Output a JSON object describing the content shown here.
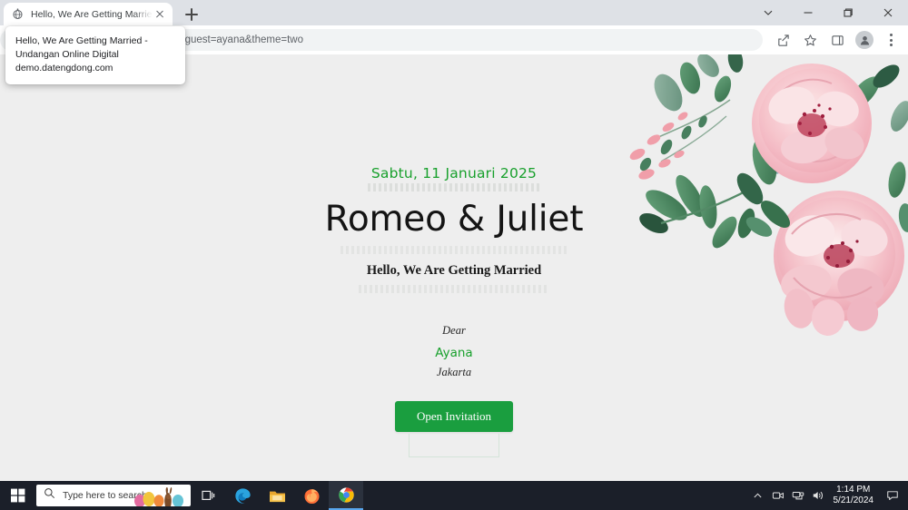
{
  "browser": {
    "tab": {
      "title": "Hello, We Are Getting Married - ",
      "favicon": "globe-icon",
      "close": "close-icon"
    },
    "new_tab_label": "+",
    "window_controls": {
      "chevron": "chevron-down-icon",
      "minimize": "minimize-icon",
      "maximize": "maximize-icon",
      "close": "close-icon"
    },
    "omnibox": {
      "url_visible_fragment": "om/?guest=ayana&theme=two",
      "url_bold_part": "om",
      "url_rest": "/?guest=ayana&theme=two"
    },
    "toolbar_icons": [
      "share-icon",
      "star-icon",
      "side-panel-icon",
      "profile-avatar-icon",
      "kebab-menu-icon"
    ],
    "tooltip": {
      "line1": "Hello, We Are Getting Married -",
      "line2": "Undangan Online Digital",
      "line3": "demo.datengdong.com"
    }
  },
  "page": {
    "background_color": "#eeeeee",
    "accent_green": "#18a02c",
    "button_green": "#1a9e3f",
    "date": "Sabtu, 11 Januari 2025",
    "couple_names": "Romeo & Juliet",
    "subtitle": "Hello, We Are Getting Married",
    "dear_label": "Dear",
    "guest_name": "Ayana",
    "guest_city": "Jakarta",
    "open_button": "Open Invitation",
    "artwork": "watercolor-floral-roses"
  },
  "taskbar": {
    "start": "windows-start-icon",
    "search_placeholder": "Type here to search",
    "search_icon": "search-icon",
    "decoration": "easter-bunny-eggs-icon",
    "pinned": [
      "task-view-icon",
      "edge-icon",
      "file-explorer-icon",
      "firefox-icon",
      "chrome-icon"
    ],
    "tray": [
      "chevron-up-icon",
      "meet-now-icon",
      "network-icon",
      "volume-icon"
    ],
    "time": "1:14 PM",
    "date": "5/21/2024",
    "notifications": "notification-icon"
  }
}
